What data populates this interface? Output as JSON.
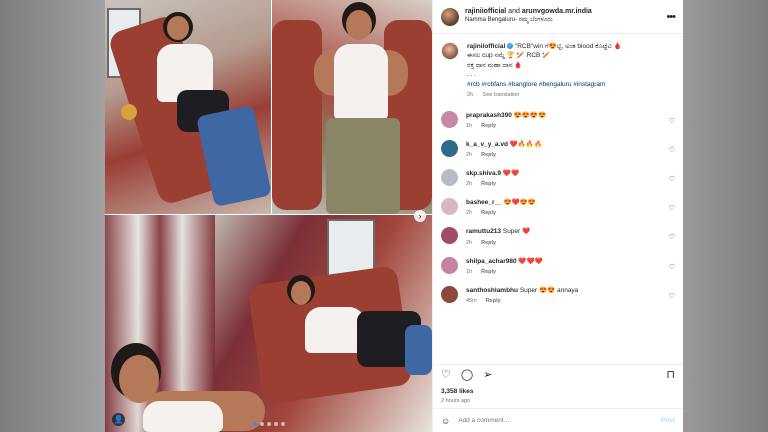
{
  "header": {
    "username1": "rajiniiofficial",
    "and": " and ",
    "username2": "arunvgowda.mr.india",
    "location": "Namma Bengaluru- ನಮ್ಮ ಬೆಂಗಳೂರು"
  },
  "caption": {
    "username": "rajiniiofficial",
    "line1": "\"RCB\"win ಗೆ😍ಟ್ಟಿ, ಅಂತ blood ಕೊಟ್ಟೆವಿ 🩸",
    "line2": "ಈಸಲ cup ನಮ್ದೆ 🏆 🏏 RCB 🏏",
    "line3": "ರಕ್ತ ದಾನ ಮಹಾ ದಾನ 🩸",
    "dots": ". . .",
    "hashtags": "#rcb #rcbfans #banglore #bengaluru #instagram",
    "time": "2h",
    "translation": "See translation"
  },
  "comments": [
    {
      "user": "praprakash390",
      "text": "😍😍😍😍",
      "time": "1h",
      "reply": "Reply",
      "color": "#c58aa8"
    },
    {
      "user": "k_a_v_y_a.vd",
      "text": "❤️🔥🔥🔥",
      "time": "2h",
      "reply": "Reply",
      "color": "#2f6a8c"
    },
    {
      "user": "skp.shiva.9",
      "text": "❤️❤️",
      "time": "2h",
      "reply": "Reply",
      "color": "#b8bdc4"
    },
    {
      "user": "bashee_r__",
      "text": "😍❤️😍😍",
      "time": "2h",
      "reply": "Reply",
      "color": "#d8b6c2"
    },
    {
      "user": "ramuttu213",
      "text": "Super ❤️",
      "time": "2h",
      "reply": "Reply",
      "color": "#a14b6a"
    },
    {
      "user": "shilpa_achar980",
      "text": "❤️❤️❤️",
      "time": "1h",
      "reply": "Reply",
      "color": "#c7829e"
    },
    {
      "user": "santhoshlambhu",
      "text": "Super 😍😍 annaya",
      "time": "45m",
      "reply": "Reply",
      "color": "#8c4a3f"
    }
  ],
  "stats": {
    "likes": "3,358 likes",
    "time_ago": "2 hours ago"
  },
  "add_comment": {
    "placeholder": "Add a comment...",
    "post_label": "Post"
  },
  "icons": {
    "more": "more-options-icon",
    "like": "heart-icon",
    "comment": "comment-icon",
    "share": "share-icon",
    "save": "bookmark-icon",
    "emoji": "smiley-icon"
  },
  "colors": {
    "hashtag": "#00376b",
    "verified": "#3897f0",
    "post_button": "#b2dffc"
  }
}
